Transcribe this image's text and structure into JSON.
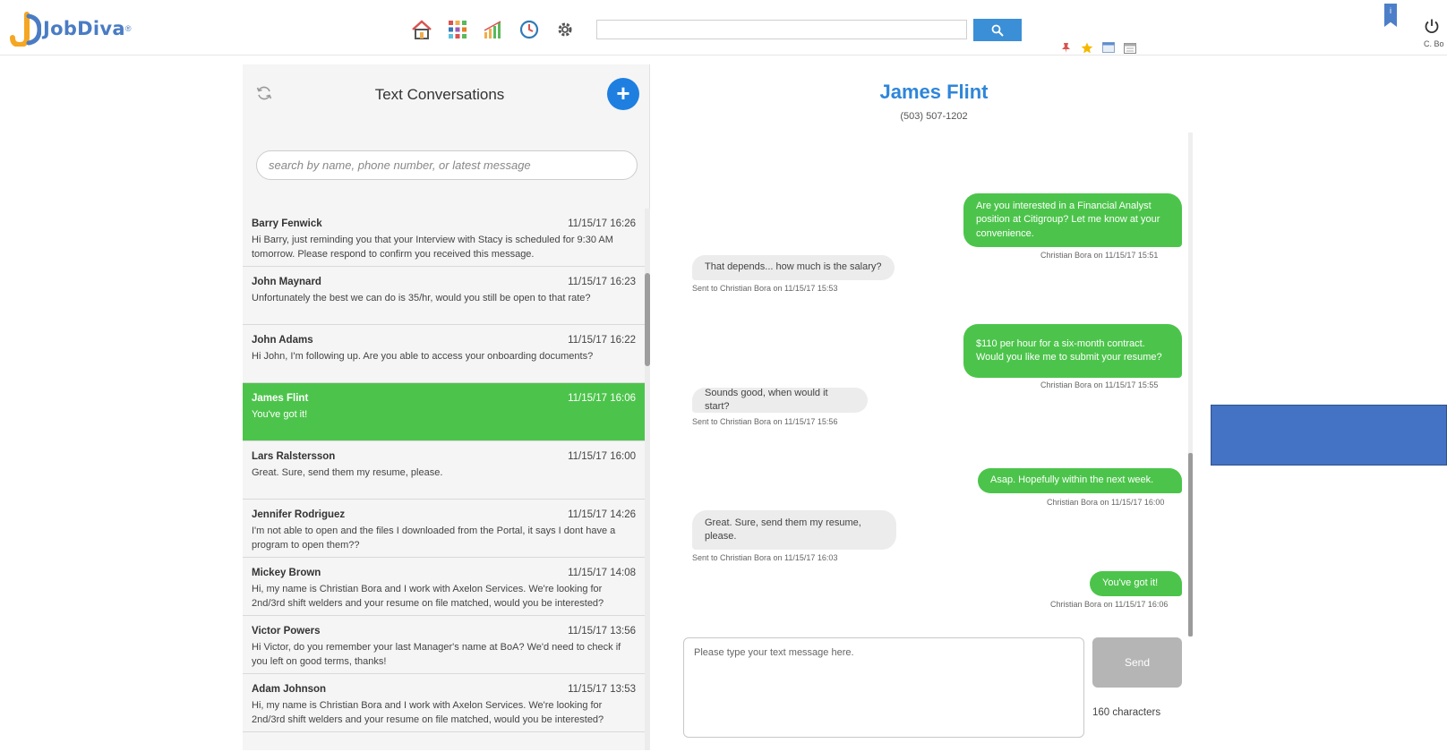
{
  "app": {
    "brand": "JobDiva",
    "brand_reg": "®",
    "user_label": "C. Bo"
  },
  "nav": {
    "icons": [
      "home-icon",
      "grid-icon",
      "chart-icon",
      "clock-icon",
      "gear-icon"
    ],
    "search_value": "",
    "quick_icons": [
      "pin-icon",
      "star-icon",
      "window-icon",
      "calendar-icon"
    ],
    "notification_badge": "i"
  },
  "conversations": {
    "title": "Text Conversations",
    "add_label": "+",
    "search_placeholder": "search by name, phone number, or latest message",
    "items": [
      {
        "name": "Barry Fenwick",
        "time": "11/15/17 16:26",
        "message": "Hi Barry, just reminding you that your Interview with Stacy is scheduled for 9:30 AM tomorrow. Please respond to confirm you received this message."
      },
      {
        "name": "John Maynard",
        "time": "11/15/17 16:23",
        "message": "Unfortunately the best we can do is 35/hr, would you still be open to that rate?"
      },
      {
        "name": "John Adams",
        "time": "11/15/17 16:22",
        "message": "Hi John, I'm following up. Are you able to access your onboarding documents?"
      },
      {
        "name": "James Flint",
        "time": "11/15/17 16:06",
        "message": "You've got it!",
        "active": true
      },
      {
        "name": "Lars Ralstersson",
        "time": "11/15/17 16:00",
        "message": "Great. Sure, send them my resume, please."
      },
      {
        "name": "Jennifer Rodriguez",
        "time": "11/15/17 14:26",
        "message": "I'm not able to open and the files I downloaded from the Portal, it says I dont have a program to open them??"
      },
      {
        "name": "Mickey Brown",
        "time": "11/15/17 14:08",
        "message": "Hi, my name is Christian Bora and I work with Axelon Services. We're looking for 2nd/3rd shift welders and your resume on file matched, would you be interested?"
      },
      {
        "name": "Victor Powers",
        "time": "11/15/17 13:56",
        "message": "Hi Victor, do you remember your last Manager's name at BoA? We'd need to check if you left on good terms, thanks!"
      },
      {
        "name": "Adam Johnson",
        "time": "11/15/17 13:53",
        "message": "Hi, my name is Christian Bora and I work with Axelon Services. We're looking for 2nd/3rd shift welders and your resume on file matched, would you be interested?"
      }
    ]
  },
  "chat": {
    "contact_name": "James Flint",
    "contact_phone": "(503) 507-1202",
    "messages": [
      {
        "direction": "out",
        "text": "Are you interested in a Financial Analyst position at Citigroup? Let me know at your convenience.",
        "meta": "Christian Bora on 11/15/17 15:51"
      },
      {
        "direction": "in",
        "text": "That depends... how much is the salary?",
        "meta": "Sent to Christian Bora on 11/15/17 15:53"
      },
      {
        "direction": "out",
        "text": "$110 per hour for a six-month contract. Would you like me to submit your resume?",
        "meta": "Christian Bora on 11/15/17 15:55"
      },
      {
        "direction": "in",
        "text": "Sounds good, when would it start?",
        "meta": "Sent to Christian Bora on 11/15/17 15:56"
      },
      {
        "direction": "out",
        "text": "Asap. Hopefully within the next week.",
        "meta": "Christian Bora on 11/15/17 16:00"
      },
      {
        "direction": "in",
        "text": "Great. Sure, send them my resume, please.",
        "meta": "Sent to Christian Bora on 11/15/17 16:03"
      },
      {
        "direction": "out",
        "text": "You've got it!",
        "meta": "Christian Bora on 11/15/17 16:06"
      }
    ],
    "composer_placeholder": "Please type your text message here.",
    "send_label": "Send",
    "char_count": "160 characters"
  },
  "colors": {
    "accent_green": "#4cc44b",
    "accent_blue": "#2e86d9",
    "overlay_blue": "#4472c4"
  }
}
